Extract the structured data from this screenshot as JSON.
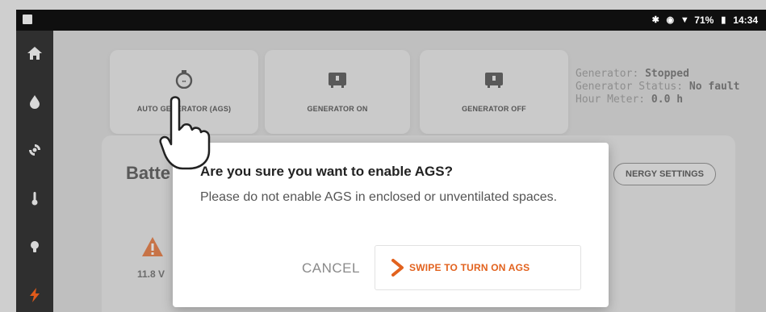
{
  "status_bar": {
    "battery_percent": "71%",
    "time": "14:34",
    "icons": [
      "bluetooth-icon",
      "target-icon",
      "wifi-icon",
      "battery-icon"
    ]
  },
  "rail": {
    "items": [
      {
        "icon": "home-icon"
      },
      {
        "icon": "water-drop-icon"
      },
      {
        "icon": "fan-icon"
      },
      {
        "icon": "thermometer-icon"
      },
      {
        "icon": "light-bulb-icon"
      },
      {
        "icon": "lightning-icon",
        "active": true
      }
    ]
  },
  "tiles": [
    {
      "label": "AUTO GENERATOR (AGS)",
      "icon": "stopwatch-icon"
    },
    {
      "label": "GENERATOR ON",
      "icon": "generator-icon"
    },
    {
      "label": "GENERATOR OFF",
      "icon": "generator-icon"
    }
  ],
  "generator_info": {
    "generator_label": "Generator:",
    "generator_value": "Stopped",
    "status_label": "Generator Status:",
    "status_value": "No fault",
    "hour_label": "Hour Meter:",
    "hour_value": "0.0 h"
  },
  "battery_card": {
    "title": "Batte",
    "energy_settings_label": "NERGY SETTINGS",
    "voltage": "11.8 V"
  },
  "dialog": {
    "title": "Are you sure you want to enable AGS?",
    "message": "Please do not enable AGS in enclosed or unventilated spaces.",
    "cancel_label": "CANCEL",
    "swipe_label": "SWIPE TO TURN ON AGS",
    "accent_color": "#e2621e"
  }
}
